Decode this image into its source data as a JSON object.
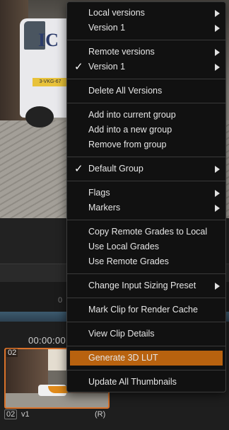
{
  "timeline": {
    "timecode": "00:00:00:",
    "ruler_tick": "0",
    "clip_number": "02",
    "clip_version": "v1",
    "clip_flag": "(R)",
    "clip_badge": "02"
  },
  "viewer": {
    "van_logo": "IC",
    "plate": "3-VKG-67"
  },
  "menu": {
    "local_versions": "Local versions",
    "local_version_1": "Version 1",
    "remote_versions": "Remote versions",
    "remote_version_1": "Version 1",
    "delete_all_versions": "Delete All Versions",
    "add_into_current_group": "Add into current group",
    "add_into_new_group": "Add into a new group",
    "remove_from_group": "Remove from group",
    "default_group": "Default Group",
    "flags": "Flags",
    "markers": "Markers",
    "copy_remote_grades": "Copy Remote Grades to Local",
    "use_local_grades": "Use Local Grades",
    "use_remote_grades": "Use Remote Grades",
    "change_input_sizing": "Change Input Sizing Preset",
    "mark_clip_render_cache": "Mark Clip for Render Cache",
    "view_clip_details": "View Clip Details",
    "generate_3d_lut": "Generate 3D LUT",
    "update_all_thumbnails": "Update All Thumbnails",
    "checkmark": "✓"
  },
  "colors": {
    "highlight": "#b8620f",
    "clip_border": "#d9722a"
  }
}
